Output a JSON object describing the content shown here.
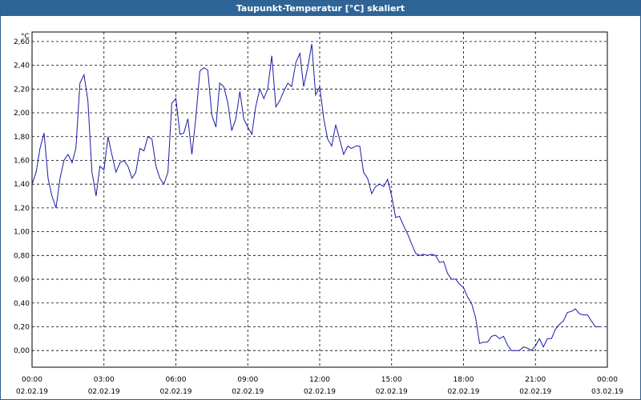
{
  "window": {
    "title": "Taupunkt-Temperatur [°C] skaliert"
  },
  "chart_data": {
    "type": "line",
    "title": "Taupunkt-Temperatur [°C] skaliert",
    "y_unit": "°C",
    "ylim": [
      -0.14,
      2.68
    ],
    "y_ticks": [
      "0,00",
      "0,20",
      "0,40",
      "0,60",
      "0,80",
      "1,00",
      "1,20",
      "1,40",
      "1,60",
      "1,80",
      "2,00",
      "2,20",
      "2,40",
      "2,60"
    ],
    "x_ticks": [
      {
        "time": "00:00",
        "date": "02.02.19"
      },
      {
        "time": "03:00",
        "date": "02.02.19"
      },
      {
        "time": "06:00",
        "date": "02.02.19"
      },
      {
        "time": "09:00",
        "date": "02.02.19"
      },
      {
        "time": "12:00",
        "date": "02.02.19"
      },
      {
        "time": "15:00",
        "date": "02.02.19"
      },
      {
        "time": "18:00",
        "date": "02.02.19"
      },
      {
        "time": "21:00",
        "date": "02.02.19"
      },
      {
        "time": "00:00",
        "date": "03.02.19"
      }
    ],
    "xlim_hours": [
      0,
      24
    ],
    "grid": true,
    "line_color": "#1a1aa6",
    "series": [
      {
        "x_hours": [
          0.0,
          0.17,
          0.33,
          0.5,
          0.67,
          0.83,
          1.0,
          1.17,
          1.33,
          1.5,
          1.67,
          1.83,
          2.0,
          2.17,
          2.33,
          2.5,
          2.67,
          2.83,
          3.0,
          3.17,
          3.33,
          3.5,
          3.67,
          3.83,
          4.0,
          4.17,
          4.33,
          4.5,
          4.67,
          4.83,
          5.0,
          5.17,
          5.33,
          5.5,
          5.67,
          5.83,
          6.0,
          6.17,
          6.33,
          6.5,
          6.67,
          6.83,
          7.0,
          7.17,
          7.33,
          7.5,
          7.67,
          7.83,
          8.0,
          8.17,
          8.33,
          8.5,
          8.67,
          8.83,
          9.0,
          9.17,
          9.33,
          9.5,
          9.67,
          9.83,
          10.0,
          10.17,
          10.33,
          10.5,
          10.67,
          10.83,
          11.0,
          11.17,
          11.33,
          11.5,
          11.67,
          11.83,
          12.0,
          12.17,
          12.33,
          12.5,
          12.67,
          12.83,
          13.0,
          13.17,
          13.33,
          13.5,
          13.67,
          13.83,
          14.0,
          14.17,
          14.33,
          14.5,
          14.67,
          14.83,
          15.0,
          15.17,
          15.33,
          15.5,
          15.67,
          15.83,
          16.0,
          16.17,
          16.33,
          16.5,
          16.67,
          16.83,
          17.0,
          17.17,
          17.33,
          17.5,
          17.67,
          17.83,
          18.0,
          18.17,
          18.33,
          18.5,
          18.67,
          18.83,
          19.0,
          19.17,
          19.33,
          19.5,
          19.67,
          19.83,
          20.0,
          20.17,
          20.33,
          20.5,
          20.67,
          20.83,
          21.0,
          21.17,
          21.33,
          21.5,
          21.67,
          21.83,
          22.0,
          22.17,
          22.33,
          22.5,
          22.67,
          22.83,
          23.0,
          23.17,
          23.33,
          23.5,
          23.67,
          23.83,
          24.0
        ],
        "values": [
          1.4,
          1.5,
          1.7,
          1.83,
          1.45,
          1.3,
          1.2,
          1.45,
          1.6,
          1.65,
          1.58,
          1.7,
          2.25,
          2.32,
          2.1,
          1.5,
          1.3,
          1.55,
          1.52,
          1.8,
          1.65,
          1.5,
          1.58,
          1.6,
          1.55,
          1.45,
          1.5,
          1.7,
          1.68,
          1.8,
          1.78,
          1.55,
          1.45,
          1.4,
          1.5,
          2.08,
          2.12,
          1.82,
          1.83,
          1.95,
          1.65,
          1.95,
          2.35,
          2.38,
          2.36,
          1.98,
          1.88,
          2.25,
          2.22,
          2.08,
          1.85,
          1.95,
          2.18,
          1.95,
          1.88,
          1.82,
          2.05,
          2.2,
          2.12,
          2.2,
          2.48,
          2.05,
          2.1,
          2.18,
          2.25,
          2.22,
          2.42,
          2.5,
          2.22,
          2.38,
          2.58,
          2.15,
          2.22,
          1.95,
          1.78,
          1.72,
          1.9,
          1.78,
          1.65,
          1.72,
          1.7,
          1.72,
          1.72,
          1.5,
          1.45,
          1.32,
          1.38,
          1.4,
          1.38,
          1.44,
          1.3,
          1.12,
          1.13,
          1.05,
          0.98,
          0.9,
          0.82,
          0.8,
          0.81,
          0.8,
          0.81,
          0.8,
          0.74,
          0.75,
          0.65,
          0.6,
          0.6,
          0.56,
          0.53,
          0.45,
          0.4,
          0.28,
          0.06,
          0.07,
          0.07,
          0.12,
          0.13,
          0.1,
          0.12,
          0.05,
          0.0,
          0.0,
          0.0,
          0.03,
          0.02,
          0.0,
          0.04,
          0.1,
          0.03,
          0.1,
          0.1,
          0.18,
          0.22,
          0.25,
          0.32,
          0.33,
          0.35,
          0.31,
          0.3,
          0.3,
          0.25,
          0.2,
          0.2
        ]
      }
    ]
  }
}
